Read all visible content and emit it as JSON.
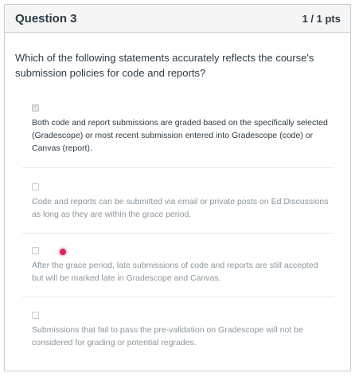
{
  "question": {
    "title": "Question 3",
    "points": "1 / 1 pts",
    "text": "Which of the following statements accurately reflects the course's submission policies for code and reports?"
  },
  "answers": [
    {
      "text": "Both code and report submissions are graded based on the specifically selected (Gradescope) or most recent submission entered into Gradescope (code) or Canvas (report).",
      "checked": true
    },
    {
      "text": "Code and reports can be submitted via email or private posts on Ed Discussions as long as they are within the grace period.",
      "checked": false
    },
    {
      "text": "After the grace period, late submissions of code and reports are still accepted but will be marked late in Gradescope and Canvas.",
      "checked": false
    },
    {
      "text": "Submissions that fail to pass the pre-validation on Gradescope will not be considered for grading or potential regrades.",
      "checked": false
    }
  ],
  "colors": {
    "text": "#2d3b45",
    "muted_text": "#8b969e",
    "header_bg": "#f5f5f5",
    "border": "#c7cdd1",
    "cursor": "#e0245e"
  }
}
